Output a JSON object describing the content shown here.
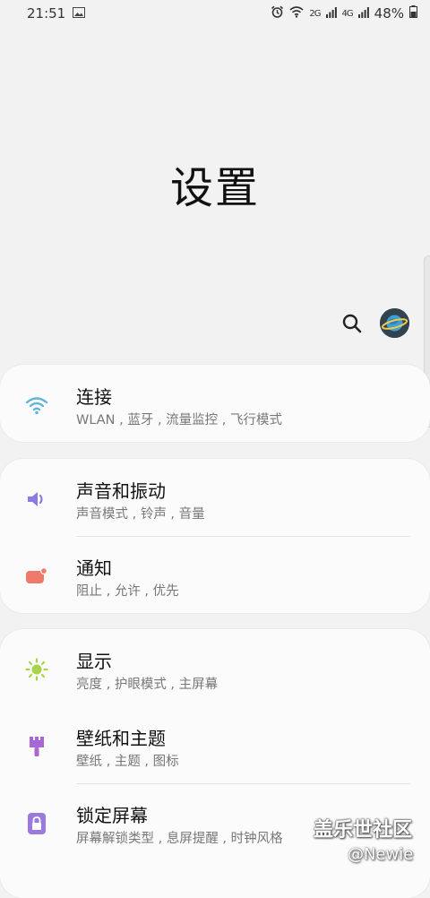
{
  "status": {
    "time": "21:51",
    "signal1": "2G",
    "signal2": "4G",
    "battery": "48%"
  },
  "page": {
    "title": "设置"
  },
  "items": [
    {
      "title": "连接",
      "subtitle": "WLAN , 蓝牙 , 流量监控 , 飞行模式",
      "icon": "wifi-icon",
      "color": "#5fb6d9"
    },
    {
      "title": "声音和振动",
      "subtitle": "声音模式 , 铃声 , 音量",
      "icon": "speaker-icon",
      "color": "#8b7be0"
    },
    {
      "title": "通知",
      "subtitle": "阻止 , 允许 , 优先",
      "icon": "notification-icon",
      "color": "#f07a6a"
    },
    {
      "title": "显示",
      "subtitle": "亮度 , 护眼模式 , 主屏幕",
      "icon": "brightness-icon",
      "color": "#a8d44a"
    },
    {
      "title": "壁纸和主题",
      "subtitle": "壁纸 , 主题 , 图标",
      "icon": "paint-brush-icon",
      "color": "#a866d6"
    },
    {
      "title": "锁定屏幕",
      "subtitle": "屏幕解锁类型 , 息屏提醒 , 时钟风格",
      "icon": "lock-icon",
      "color": "#9b7ae0"
    }
  ],
  "watermark": {
    "line1": "盖乐世社区",
    "line2": "@Newie"
  }
}
